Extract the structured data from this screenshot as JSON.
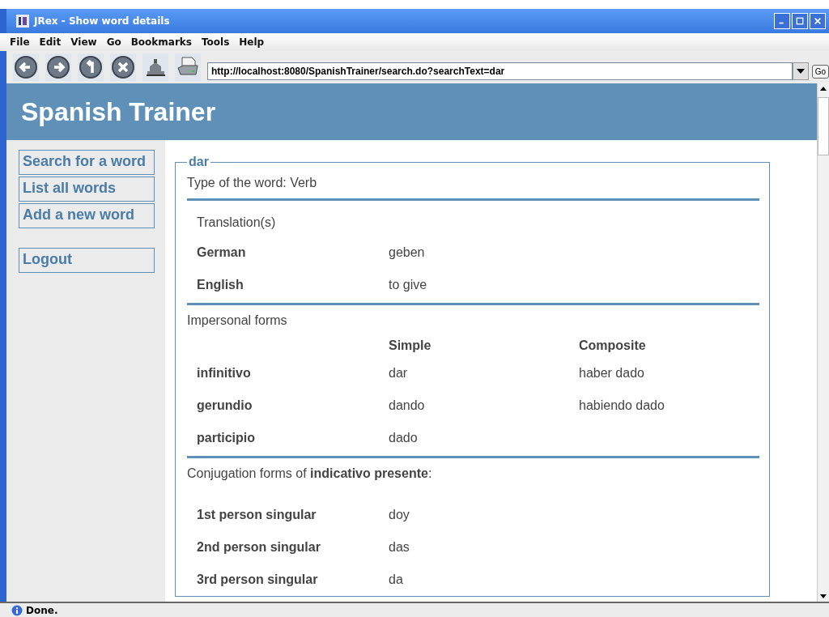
{
  "window": {
    "title": "JRex - Show word details"
  },
  "menu": [
    "File",
    "Edit",
    "View",
    "Go",
    "Bookmarks",
    "Tools",
    "Help"
  ],
  "toolbar": {
    "buttons": [
      {
        "kind": "back"
      },
      {
        "kind": "forward"
      },
      {
        "kind": "reload"
      },
      {
        "kind": "stop"
      },
      {
        "kind": "home"
      },
      {
        "kind": "print"
      }
    ],
    "url": "http://localhost:8080/SpanishTrainer/search.do?searchText=dar",
    "go": "Go"
  },
  "page": {
    "title": "Spanish Trainer",
    "sidebar": {
      "links": [
        "Search for a word",
        "List all words",
        "Add a new word"
      ],
      "bottom_links": [
        "Logout"
      ]
    },
    "word": "dar",
    "type_line": "Type of the word: Verb",
    "translations_heading": "Translation(s)",
    "translations": [
      {
        "language": "German",
        "text": "geben"
      },
      {
        "language": "English",
        "text": "to give"
      }
    ],
    "impersonal_heading": "Impersonal forms",
    "impersonal_columns": [
      "Simple",
      "Composite"
    ],
    "impersonal": [
      {
        "name": "infinitivo",
        "simple": "dar",
        "composite": "haber dado"
      },
      {
        "name": "gerundio",
        "simple": "dando",
        "composite": "habiendo dado"
      },
      {
        "name": "participio",
        "simple": "dado"
      }
    ],
    "conjugation_heading": "Conjugation forms of **indicativo presente**:",
    "conjugation": [
      {
        "person": "1st person singular",
        "form": "doy"
      },
      {
        "person": "2nd person singular",
        "form": "das"
      },
      {
        "person": "3rd person singular",
        "form": "da"
      }
    ]
  },
  "status_bar": "Done."
}
